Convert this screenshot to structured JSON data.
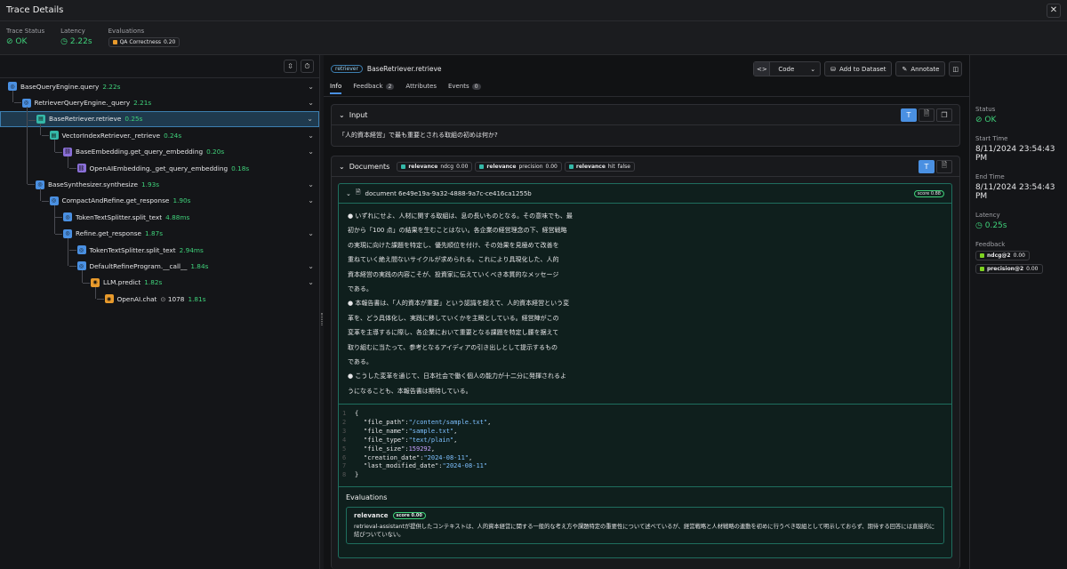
{
  "header": {
    "title": "Trace Details"
  },
  "summary": {
    "status_label": "Trace Status",
    "status_value": "OK",
    "latency_label": "Latency",
    "latency_value": "2.22s",
    "evals_label": "Evaluations",
    "eval_name": "QA Correctness",
    "eval_value": "0.20"
  },
  "tree": [
    {
      "name": "BaseQueryEngine.query",
      "dur": "2.22s",
      "icon": "blue",
      "depth": 0
    },
    {
      "name": "RetrieverQueryEngine._query",
      "dur": "2.21s",
      "icon": "blue",
      "depth": 1
    },
    {
      "name": "BaseRetriever.retrieve",
      "dur": "0.25s",
      "icon": "teal",
      "depth": 2
    },
    {
      "name": "VectorIndexRetriever._retrieve",
      "dur": "0.24s",
      "icon": "teal",
      "depth": 3
    },
    {
      "name": "BaseEmbedding.get_query_embedding",
      "dur": "0.20s",
      "icon": "purple",
      "depth": 4
    },
    {
      "name": "OpenAIEmbedding._get_query_embedding",
      "dur": "0.18s",
      "icon": "purple",
      "depth": 5
    },
    {
      "name": "BaseSynthesizer.synthesize",
      "dur": "1.93s",
      "icon": "blue",
      "depth": 2
    },
    {
      "name": "CompactAndRefine.get_response",
      "dur": "1.90s",
      "icon": "blue",
      "depth": 3
    },
    {
      "name": "TokenTextSplitter.split_text",
      "dur": "4.88ms",
      "icon": "blue",
      "depth": 4
    },
    {
      "name": "Refine.get_response",
      "dur": "1.87s",
      "icon": "blue",
      "depth": 4
    },
    {
      "name": "TokenTextSplitter.split_text",
      "dur": "2.94ms",
      "icon": "blue",
      "depth": 5
    },
    {
      "name": "DefaultRefineProgram.__call__",
      "dur": "1.84s",
      "icon": "blue",
      "depth": 5
    },
    {
      "name": "LLM.predict",
      "dur": "1.82s",
      "icon": "orange",
      "depth": 6
    },
    {
      "name": "OpenAI.chat",
      "dur": "1.81s",
      "icon": "orange",
      "depth": 7,
      "tokens": "1078"
    }
  ],
  "span": {
    "kind": "retriever",
    "title": "BaseRetriever.retrieve"
  },
  "toolbar": {
    "code_label": "Code",
    "add_label": "Add to Dataset",
    "annotate_label": "Annotate"
  },
  "tabs": [
    {
      "label": "Info",
      "count": ""
    },
    {
      "label": "Feedback",
      "count": "2"
    },
    {
      "label": "Attributes",
      "count": ""
    },
    {
      "label": "Events",
      "count": "0"
    }
  ],
  "input": {
    "title": "Input",
    "text": "「人的資本経営」で最も重要とされる取組の初めは何か?"
  },
  "documents": {
    "title": "Documents",
    "chips": [
      {
        "label": "relevance",
        "metric": "ndcg",
        "value": "0.00"
      },
      {
        "label": "relevance",
        "metric": "precision",
        "value": "0.00"
      },
      {
        "label": "relevance",
        "metric": "hit",
        "value": "false"
      }
    ],
    "doc_id": "document 6e49e19a-9a32-4888-9a7c-ce416ca1255b",
    "score": "score 0.88",
    "lines": [
      "●  いずれにせよ、人材に関する取組は、息の長いものとなる。その意味でも、最",
      "初から「100 点」の結果を生むことはない。各企業の経営理念の下、経営戦略",
      "の実現に向けた課題を特定し、優先順位を付け、その効果を見極めて改善を",
      "重ねていく絶え間ないサイクルが求められる。これにより具現化した、人的",
      "資本経営の実践の内容こそが、投資家に伝えていくべき本質的なメッセージ",
      "である。",
      "●  本報告書は、「人的資本が重要」という認識を超えて、人的資本経営という変",
      "革を、どう具体化し、実践に移していくかを主眼としている。経営陣がこの",
      "変革を主導するに際し、各企業において重要となる課題を特定し腰を据えて",
      "取り組むに当たって、参考となるアイディアの引き出しとして提示するもの",
      "である。",
      "●  こうした変革を通じて、日本社会で働く個人の能力が十二分に発揮されるよ",
      "うになることも、本報告書は期待している。"
    ],
    "code": [
      {
        "n": "1",
        "text": "{"
      },
      {
        "n": "2",
        "k": "\"file_path\"",
        "v": "\"/content/sample.txt\"",
        "t": "s",
        "c": ","
      },
      {
        "n": "3",
        "k": "\"file_name\"",
        "v": "\"sample.txt\"",
        "t": "s",
        "c": ","
      },
      {
        "n": "4",
        "k": "\"file_type\"",
        "v": "\"text/plain\"",
        "t": "s",
        "c": ","
      },
      {
        "n": "5",
        "k": "\"file_size\"",
        "v": "159292",
        "t": "n",
        "c": ","
      },
      {
        "n": "6",
        "k": "\"creation_date\"",
        "v": "\"2024-08-11\"",
        "t": "s",
        "c": ","
      },
      {
        "n": "7",
        "k": "\"last_modified_date\"",
        "v": "\"2024-08-11\"",
        "t": "s",
        "c": ""
      },
      {
        "n": "8",
        "text": "}"
      }
    ],
    "evals_title": "Evaluations",
    "eval_name": "relevance",
    "eval_score": "score 0.00",
    "eval_text": "retrieval-assistantが提供したコンテキストは、人的資本経営に関する一般的な考え方や課題特定の重要性について述べているが、経営戦略と人材戦略の連動を初めに行うべき取組として明示しておらず、期待する回答には直接的に結びついていない。"
  },
  "details": {
    "status_label": "Status",
    "status_value": "OK",
    "start_label": "Start Time",
    "start_value": "8/11/2024 23:54:43 PM",
    "end_label": "End Time",
    "end_value": "8/11/2024 23:54:43 PM",
    "latency_label": "Latency",
    "latency_value": "0.25s",
    "feedback_label": "Feedback",
    "feedback": [
      {
        "name": "ndcg@2",
        "value": "0.00"
      },
      {
        "name": "precision@2",
        "value": "0.00"
      }
    ]
  },
  "colors": {
    "ok": "#3fd17a",
    "accent": "#4a90e2",
    "doc_border": "#1f6e5e"
  }
}
